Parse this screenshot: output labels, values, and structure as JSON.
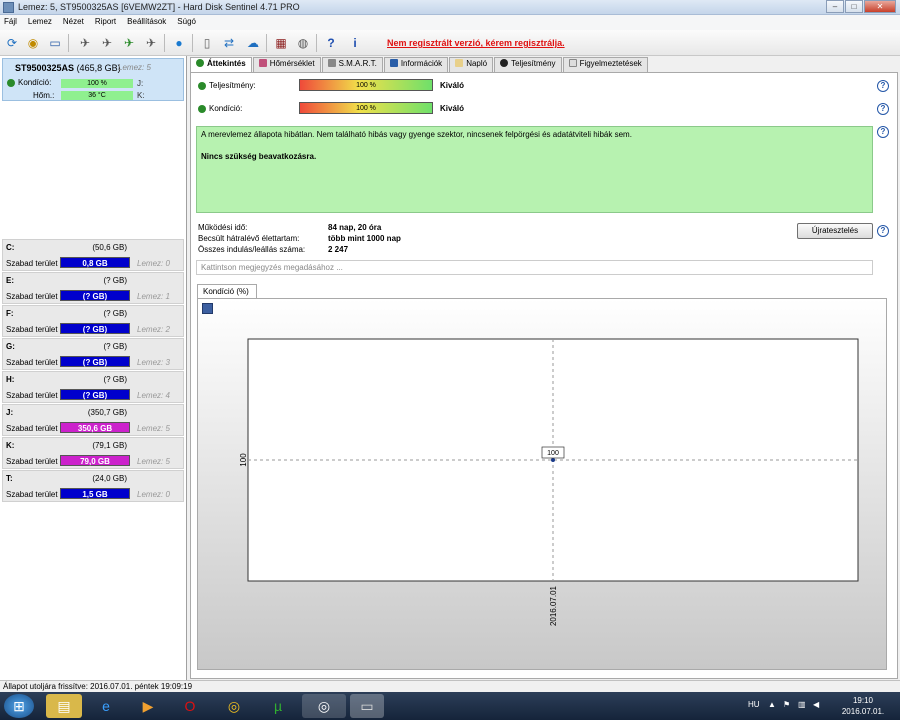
{
  "window": {
    "title": "Lemez: 5, ST9500325AS [6VEMW2ZT]  -  Hard Disk Sentinel 4.71 PRO"
  },
  "menu": [
    "Fájl",
    "Lemez",
    "Nézet",
    "Riport",
    "Beállítások",
    "Súgó"
  ],
  "toolbar": {
    "registration_notice": "Nem regisztrált verzió, kérem regisztrálja."
  },
  "disk": {
    "name": "ST9500325AS",
    "size": "(465,8 GB)",
    "lemez": "Lemez: 5",
    "condition_label": "Kondíció:",
    "condition_value": "100 %",
    "condition_side": "J:",
    "temp_label": "Hőm.:",
    "temp_value": "36 °C",
    "temp_side": "K:"
  },
  "drives": [
    {
      "letter": "C:",
      "size": "(50,6 GB)",
      "free_label": "Szabad terület",
      "free": "0,8 GB",
      "lemez": "Lemez: 0",
      "color": "#0000cc"
    },
    {
      "letter": "E:",
      "size": "(? GB)",
      "free_label": "Szabad terület",
      "free": "(? GB)",
      "lemez": "Lemez: 1",
      "color": "#0000cc"
    },
    {
      "letter": "F:",
      "size": "(? GB)",
      "free_label": "Szabad terület",
      "free": "(? GB)",
      "lemez": "Lemez: 2",
      "color": "#0000cc"
    },
    {
      "letter": "G:",
      "size": "(? GB)",
      "free_label": "Szabad terület",
      "free": "(? GB)",
      "lemez": "Lemez: 3",
      "color": "#0000cc"
    },
    {
      "letter": "H:",
      "size": "(? GB)",
      "free_label": "Szabad terület",
      "free": "(? GB)",
      "lemez": "Lemez: 4",
      "color": "#0000cc"
    },
    {
      "letter": "J:",
      "size": "(350,7 GB)",
      "free_label": "Szabad terület",
      "free": "350,6 GB",
      "lemez": "Lemez: 5",
      "color": "#cc22cc"
    },
    {
      "letter": "K:",
      "size": "(79,1 GB)",
      "free_label": "Szabad terület",
      "free": "79,0 GB",
      "lemez": "Lemez: 5",
      "color": "#cc22cc"
    },
    {
      "letter": "T:",
      "size": "(24,0 GB)",
      "free_label": "Szabad terület",
      "free": "1,5 GB",
      "lemez": "Lemez: 0",
      "color": "#0000cc"
    }
  ],
  "tabs": [
    "Áttekintés",
    "Hőmérséklet",
    "S.M.A.R.T.",
    "Információk",
    "Napló",
    "Teljesítmény",
    "Figyelmeztetések"
  ],
  "overview": {
    "performance_label": "Teljesítmény:",
    "performance_value": "100 %",
    "performance_status": "Kiváló",
    "condition_label": "Kondíció:",
    "condition_value": "100 %",
    "condition_status": "Kiváló",
    "message": "A merevlemez állapota hibátlan. Nem található hibás vagy gyenge szektor, nincsenek felpörgési és adatátviteli hibák sem.",
    "message_bold": "Nincs szükség beavatkozásra.",
    "uptime_label": "Működési idő:",
    "uptime_value": "84 nap, 20 óra",
    "remaining_label": "Becsült hátralévő élettartam:",
    "remaining_value": "több mint 1000 nap",
    "startstop_label": "Összes indulás/leállás száma:",
    "startstop_value": "2 247",
    "retest_button": "Újratesztelés",
    "note_placeholder": "Kattintson megjegyzés megadásához ..."
  },
  "chart_tab": "Kondíció  (%)",
  "chart_data": {
    "type": "line",
    "x": [
      "2016.07.01"
    ],
    "series": [
      {
        "values": [
          100
        ]
      }
    ],
    "data_labels": [
      "100"
    ],
    "y_tick": "100",
    "x_tick": "2016.07.01",
    "grid": true
  },
  "statusbar": {
    "text": "Állapot utoljára frissítve: 2016.07.01. péntek 19:09:19"
  },
  "taskbar": {
    "lang": "HU",
    "time": "19:10",
    "date": "2016.07.01."
  }
}
